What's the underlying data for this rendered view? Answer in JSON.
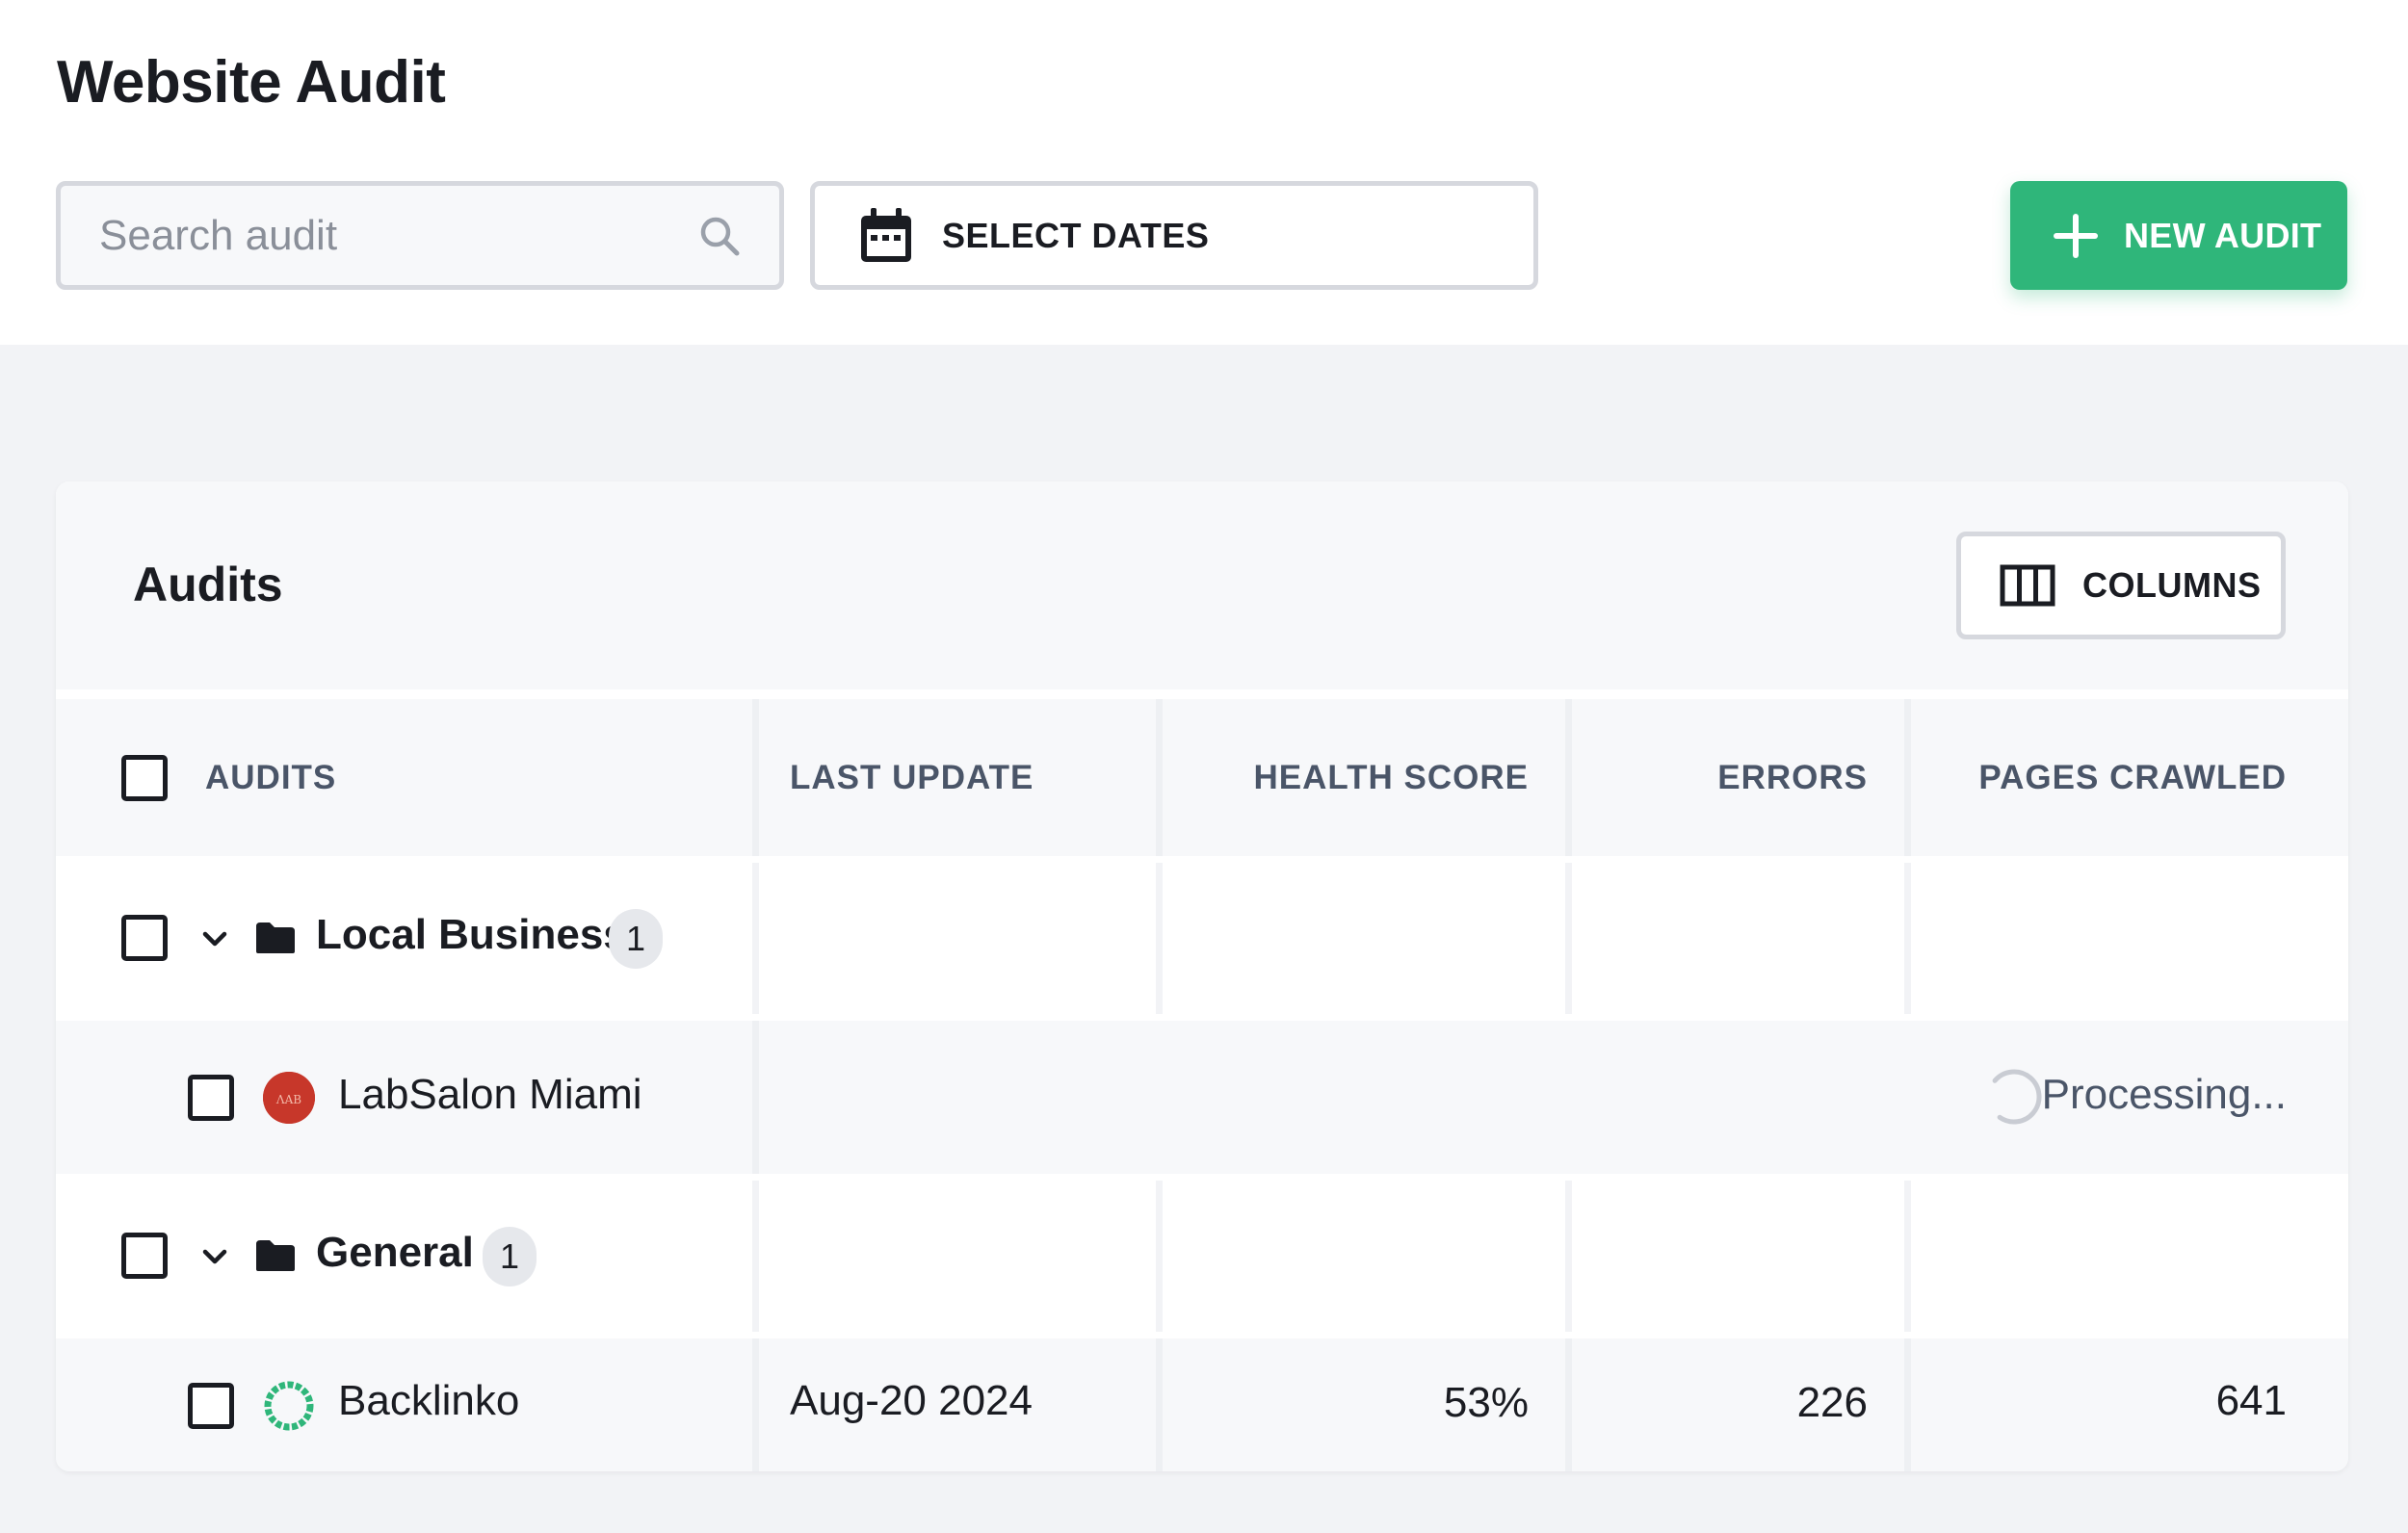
{
  "page": {
    "title": "Website Audit"
  },
  "toolbar": {
    "search_placeholder": "Search audit",
    "search_icon": "search-icon",
    "dates_label": "SELECT DATES",
    "dates_icon": "calendar-icon",
    "new_audit_label": "NEW AUDIT",
    "new_audit_icon": "plus-icon",
    "accent_color": "#2fb67a"
  },
  "card": {
    "title": "Audits",
    "columns_label": "COLUMNS",
    "columns_icon": "columns-icon"
  },
  "table": {
    "headers": [
      "AUDITS",
      "LAST UPDATE",
      "HEALTH SCORE",
      "ERRORS",
      "PAGES CRAWLED"
    ],
    "groups": [
      {
        "name": "Local Business",
        "count": "1",
        "expanded": true,
        "items": [
          {
            "name": "LabSalon Miami",
            "avatar_color": "#c7372a",
            "status": "Processing..."
          }
        ]
      },
      {
        "name": "General",
        "count": "1",
        "expanded": true,
        "items": [
          {
            "name": "Backlinko",
            "avatar_color": "#2fb67a",
            "last_update": "Aug-20 2024",
            "health_score": "53%",
            "errors": "226",
            "pages_crawled": "641"
          }
        ]
      }
    ]
  }
}
